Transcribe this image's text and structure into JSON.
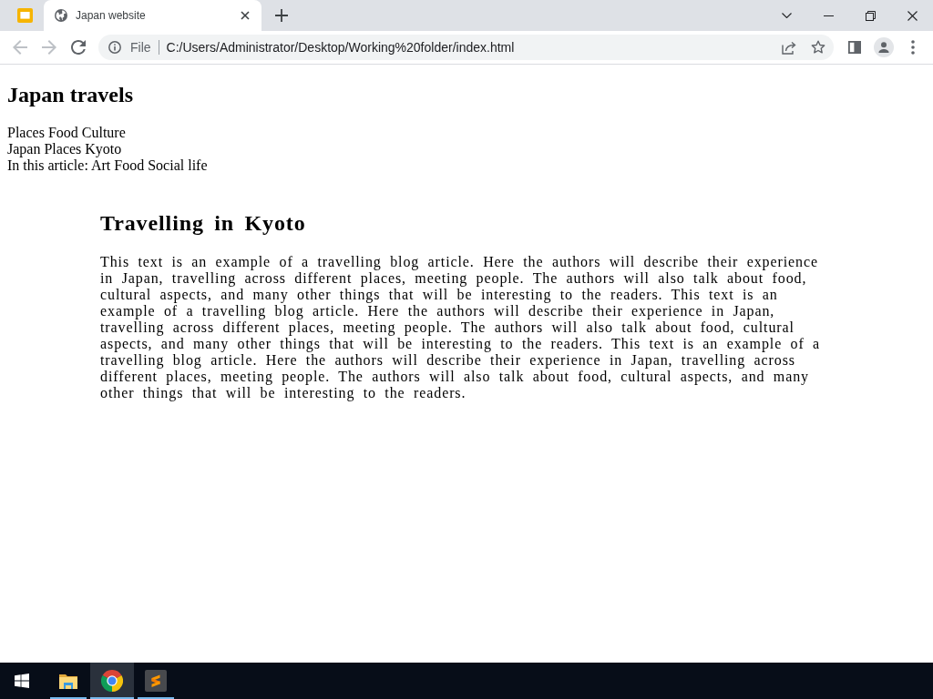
{
  "browser": {
    "tabs": [
      {
        "title": "Japan website",
        "selected": true
      }
    ],
    "toolbar": {
      "back": {
        "disabled": true
      },
      "forward": {
        "disabled": true
      }
    },
    "address": {
      "scheme": "File",
      "url": "C:/Users/Administrator/Desktop/Working%20folder/index.html"
    }
  },
  "page": {
    "title": "Japan travels",
    "nav": [
      "Places",
      "Food",
      "Culture"
    ],
    "breadcrumb": [
      "Japan",
      "Places",
      "Kyoto"
    ],
    "contents": {
      "label": "In this article:",
      "items": [
        "Art",
        "Food",
        "Social life"
      ]
    },
    "article": {
      "heading": "Travelling in Kyoto",
      "body": "This text is an example of a travelling blog article. Here the authors will describe their experience in Japan, travelling across different places, meeting people. The authors will also talk about food, cultural aspects, and many other things that will be interesting to the readers. This text is an example of a travelling blog article. Here the authors will describe their experience in Japan, travelling across different places, meeting people. The authors will also talk about food, cultural aspects, and many other things that will be interesting to the readers. This text is an example of a travelling blog article. Here the authors will describe their experience in Japan, travelling across different places, meeting people. The authors will also talk about food, cultural aspects, and many other things that will be interesting to the readers."
    }
  },
  "taskbar": {
    "apps": [
      {
        "kind": "folder",
        "selected": false,
        "running": true
      },
      {
        "kind": "browser",
        "selected": true,
        "running": true
      },
      {
        "kind": "editor",
        "selected": false,
        "running": true
      }
    ]
  }
}
